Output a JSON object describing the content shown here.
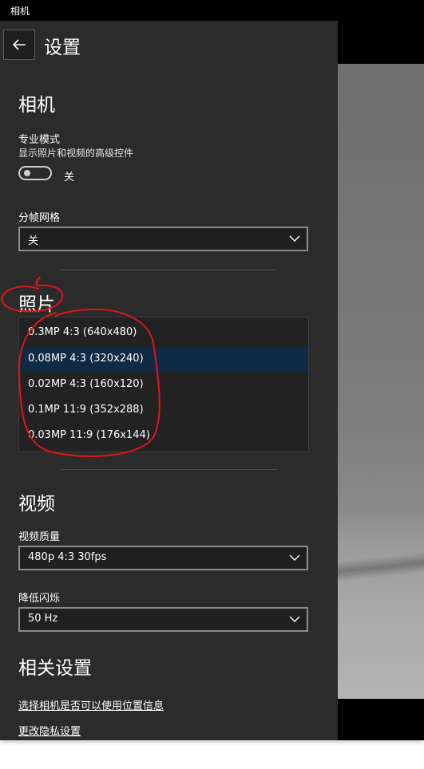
{
  "window": {
    "title": "相机"
  },
  "header": {
    "title": "设置"
  },
  "camera": {
    "section_title": "相机",
    "pro_mode": {
      "label": "专业模式",
      "description": "显示照片和视频的高级控件",
      "state": "关",
      "on": false
    },
    "framing_grid": {
      "label": "分帧网格",
      "value": "关"
    }
  },
  "photo": {
    "section_title": "照片",
    "resolutions": [
      {
        "label": "0.3MP 4:3 (640x480)",
        "selected": false
      },
      {
        "label": "0.08MP 4:3 (320x240)",
        "selected": true
      },
      {
        "label": "0.02MP 4:3 (160x120)",
        "selected": false
      },
      {
        "label": "0.1MP 11:9 (352x288)",
        "selected": false
      },
      {
        "label": "0.03MP 11:9 (176x144)",
        "selected": false
      }
    ]
  },
  "video": {
    "section_title": "视频",
    "quality": {
      "label": "视频质量",
      "value": "480p 4:3 30fps"
    },
    "flicker": {
      "label": "降低闪烁",
      "value": "50 Hz"
    }
  },
  "related": {
    "section_title": "相关设置",
    "links": [
      "选择相机是否可以使用位置信息",
      "更改隐私设置"
    ]
  },
  "colors": {
    "panel_bg": "#2b2b2b",
    "selected_item": "#0f2a44",
    "annotation": "#e0161b"
  },
  "icons": {
    "back": "arrow-left-icon",
    "dropdown": "chevron-down-icon"
  }
}
